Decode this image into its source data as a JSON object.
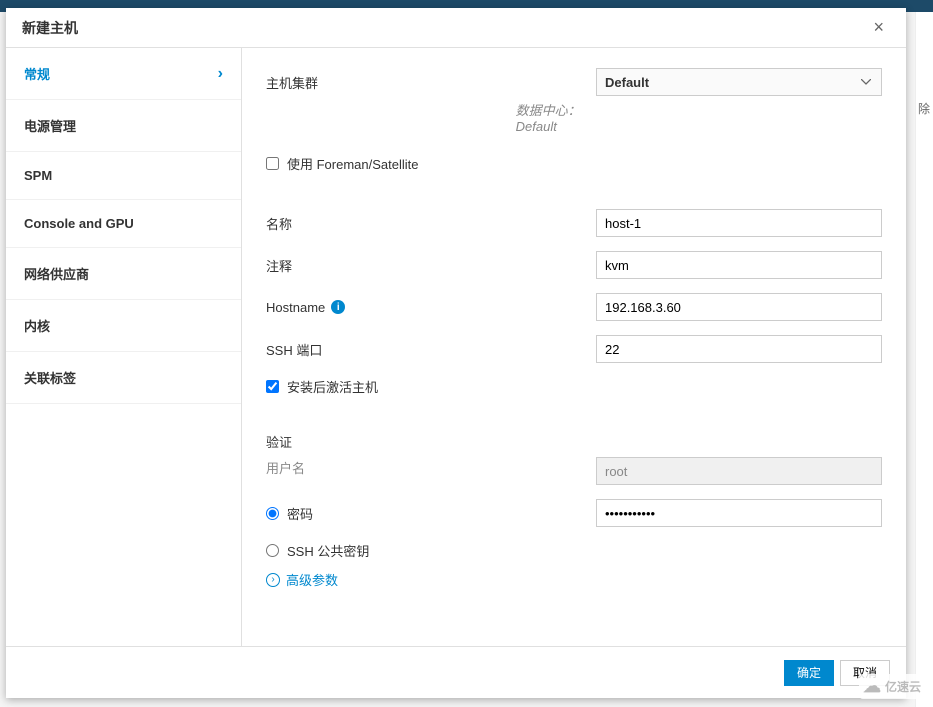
{
  "modal": {
    "title": "新建主机",
    "close_label": "×"
  },
  "sidebar": {
    "items": [
      {
        "label": "常规",
        "active": true
      },
      {
        "label": "电源管理"
      },
      {
        "label": "SPM"
      },
      {
        "label": "Console and GPU"
      },
      {
        "label": "网络供应商"
      },
      {
        "label": "内核"
      },
      {
        "label": "关联标签"
      }
    ]
  },
  "form": {
    "cluster_label": "主机集群",
    "cluster_value": "Default",
    "datacenter_label": "数据中心：",
    "datacenter_value": "Default",
    "foreman_label": "使用 Foreman/Satellite",
    "foreman_checked": false,
    "name_label": "名称",
    "name_value": "host-1",
    "comment_label": "注释",
    "comment_value": "kvm",
    "hostname_label": "Hostname",
    "hostname_value": "192.168.3.60",
    "ssh_port_label": "SSH 端口",
    "ssh_port_value": "22",
    "activate_label": "安装后激活主机",
    "activate_checked": true,
    "auth_title": "验证",
    "username_label": "用户名",
    "username_value": "root",
    "password_radio_label": "密码",
    "password_value": "•••••••••••",
    "sshkey_radio_label": "SSH 公共密钥",
    "auth_mode": "password",
    "advanced_label": "高级参数"
  },
  "footer": {
    "ok_label": "确定",
    "cancel_label": "取消"
  },
  "watermark": "亿速云",
  "peek": "除"
}
